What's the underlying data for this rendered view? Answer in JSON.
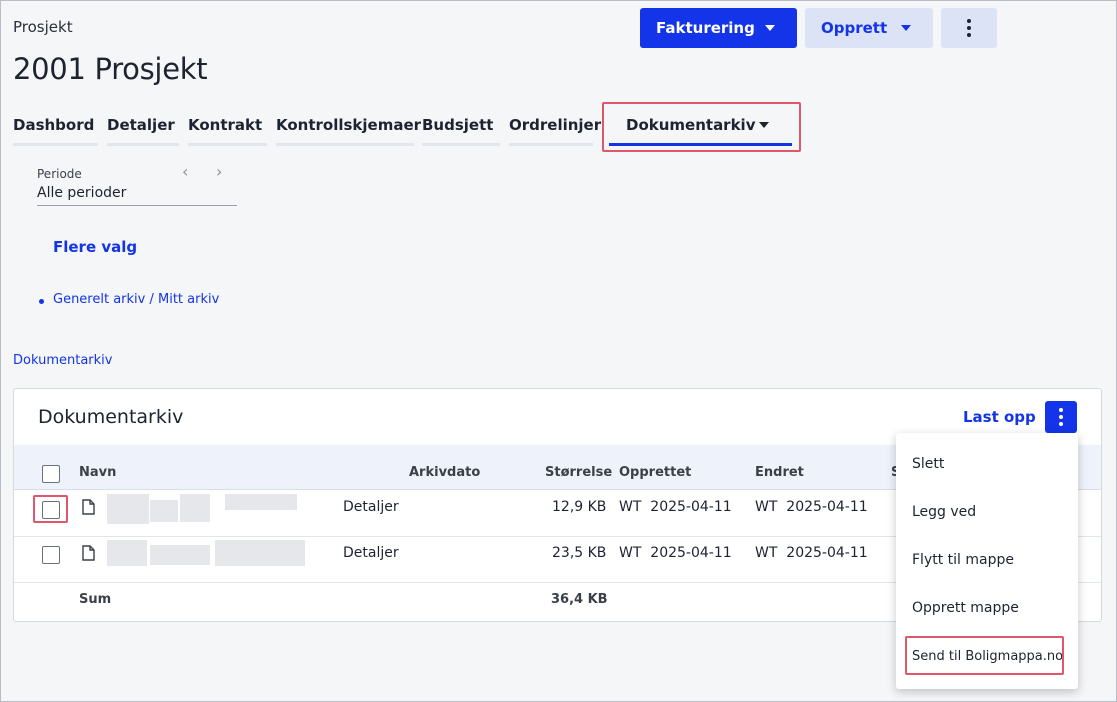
{
  "header": {
    "breadcrumb": "Prosjekt",
    "title": "2001 Prosjekt"
  },
  "toolbar": {
    "fakturering_label": "Fakturering",
    "opprett_label": "Opprett"
  },
  "tabs": [
    {
      "label": "Dashbord"
    },
    {
      "label": "Detaljer"
    },
    {
      "label": "Kontrakt"
    },
    {
      "label": "Kontrollskjemaer"
    },
    {
      "label": "Budsjett"
    },
    {
      "label": "Ordrelinjer"
    },
    {
      "label": "Dokumentarkiv",
      "active": true
    }
  ],
  "filter": {
    "periode_label": "Periode",
    "periode_value": "Alle perioder",
    "more_options": "Flere valg"
  },
  "archive_link": "Generelt arkiv / Mitt arkiv",
  "section_link": "Dokumentarkiv",
  "card": {
    "title": "Dokumentarkiv",
    "upload_label": "Last opp",
    "columns": [
      "Navn",
      "Arkivdato",
      "Størrelse",
      "Opprettet",
      "Endret",
      "S"
    ],
    "rows": [
      {
        "details": "Detaljer",
        "size": "12,9 KB",
        "created": "WT  2025-04-11",
        "changed": "WT  2025-04-11"
      },
      {
        "details": "Detaljer",
        "size": "23,5 KB",
        "created": "WT  2025-04-11",
        "changed": "WT  2025-04-11"
      }
    ],
    "sum_label": "Sum",
    "sum_value": "36,4 KB"
  },
  "menu": {
    "items": [
      "Slett",
      "Legg ved",
      "Flytt til mappe",
      "Opprett mappe",
      "Send til Boligmappa.no"
    ]
  },
  "colors": {
    "accent": "#1334e8",
    "highlight": "#e0566a"
  }
}
